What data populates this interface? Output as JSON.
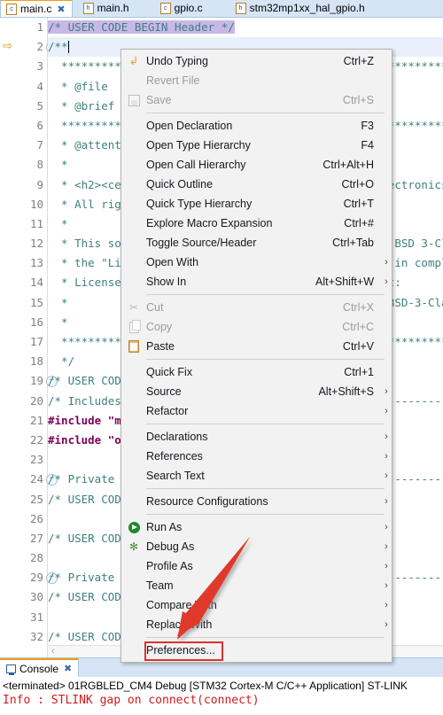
{
  "tabs": [
    {
      "label": "main.c",
      "icon": "c-file-icon",
      "icon_letter": "c",
      "active": true,
      "close": "✖"
    },
    {
      "label": "main.h",
      "icon": "h-file-icon",
      "icon_letter": "h",
      "active": false
    },
    {
      "label": "gpio.c",
      "icon": "c-file-icon",
      "icon_letter": "c",
      "active": false
    },
    {
      "label": "stm32mp1xx_hal_gpio.h",
      "icon": "h-file-icon",
      "icon_letter": "h",
      "active": false
    }
  ],
  "editor": {
    "marker_icon": "execution-arrow-icon",
    "hscroll_left_icon": "‹",
    "lines": [
      {
        "n": "1",
        "fold": false,
        "text": "/* USER CODE BEGIN Header */",
        "style": "cmt",
        "highlight": "selection"
      },
      {
        "n": "2",
        "fold": true,
        "text": "/**",
        "style": "cmt",
        "highlight": "line",
        "caret": true
      },
      {
        "n": "3",
        "fold": false,
        "text": "  ******************************************************************************",
        "style": "cmt"
      },
      {
        "n": "4",
        "fold": false,
        "text": "  * @file           : main.c",
        "style": "cmt"
      },
      {
        "n": "5",
        "fold": false,
        "text": "  * @brief          : Main program body",
        "style": "cmt"
      },
      {
        "n": "6",
        "fold": false,
        "text": "  ******************************************************************************",
        "style": "cmt"
      },
      {
        "n": "7",
        "fold": false,
        "text": "  * @attention",
        "style": "cmt"
      },
      {
        "n": "8",
        "fold": false,
        "text": "  *",
        "style": "cmt"
      },
      {
        "n": "9",
        "fold": false,
        "text": "  * <h2><center>&copy; Copyright (c) 2020 STMicroelectronics.",
        "style": "cmt"
      },
      {
        "n": "10",
        "fold": false,
        "text": "  * All rights reserved.</center></h2>",
        "style": "cmt"
      },
      {
        "n": "11",
        "fold": false,
        "text": "  *",
        "style": "cmt"
      },
      {
        "n": "12",
        "fold": false,
        "text": "  * This software component is licensed by ST under BSD 3-Clause license,",
        "style": "cmt"
      },
      {
        "n": "13",
        "fold": false,
        "text": "  * the \"License\"; You may not use this file except in compliance with the",
        "style": "cmt"
      },
      {
        "n": "14",
        "fold": false,
        "text": "  * License. You may obtain a copy of the License at:",
        "style": "cmt"
      },
      {
        "n": "15",
        "fold": false,
        "text": "  *                        opensource.org/licenses/BSD-3-Clause",
        "style": "cmt"
      },
      {
        "n": "16",
        "fold": false,
        "text": "  *",
        "style": "cmt"
      },
      {
        "n": "17",
        "fold": false,
        "text": "  ******************************************************************************",
        "style": "cmt"
      },
      {
        "n": "18",
        "fold": false,
        "text": "  */",
        "style": "cmt"
      },
      {
        "n": "19",
        "fold": true,
        "text": "/* USER CODE END Header */",
        "style": "cmt"
      },
      {
        "n": "20",
        "fold": false,
        "text": "/* Includes ------------------------------------------------------------------*/",
        "style": "cmt"
      },
      {
        "n": "21",
        "fold": false,
        "text": "#include \"main.h\"",
        "style": "pre"
      },
      {
        "n": "22",
        "fold": false,
        "text": "#include \"openamp.h\"",
        "style": "pre"
      },
      {
        "n": "23",
        "fold": false,
        "text": "",
        "style": ""
      },
      {
        "n": "24",
        "fold": true,
        "text": "/* Private includes ----------------------------------------------------------*/",
        "style": "cmt"
      },
      {
        "n": "25",
        "fold": false,
        "text": "/* USER CODE BEGIN Includes */",
        "style": "cmt"
      },
      {
        "n": "26",
        "fold": false,
        "text": "",
        "style": ""
      },
      {
        "n": "27",
        "fold": false,
        "text": "/* USER CODE END Includes */",
        "style": "cmt"
      },
      {
        "n": "28",
        "fold": false,
        "text": "",
        "style": ""
      },
      {
        "n": "29",
        "fold": true,
        "text": "/* Private typedef -----------------------------------------------------------*/",
        "style": "cmt"
      },
      {
        "n": "30",
        "fold": false,
        "text": "/* USER CODE BEGIN PTD */",
        "style": "cmt"
      },
      {
        "n": "31",
        "fold": false,
        "text": "",
        "style": ""
      },
      {
        "n": "32",
        "fold": false,
        "text": "/* USER CODE END PTD */",
        "style": "cmt"
      }
    ]
  },
  "context_menu": {
    "items": [
      {
        "type": "item",
        "name": "undo-typing",
        "label": "Undo Typing",
        "accel": "Ctrl+Z",
        "icon": "undo-icon",
        "disabled": false,
        "submenu": false
      },
      {
        "type": "item",
        "name": "revert-file",
        "label": "Revert File",
        "accel": "",
        "icon": "",
        "disabled": true,
        "submenu": false
      },
      {
        "type": "item",
        "name": "save",
        "label": "Save",
        "accel": "Ctrl+S",
        "icon": "save-icon",
        "disabled": true,
        "submenu": false
      },
      {
        "type": "sep"
      },
      {
        "type": "item",
        "name": "open-declaration",
        "label": "Open Declaration",
        "accel": "F3",
        "icon": "",
        "disabled": false,
        "submenu": false
      },
      {
        "type": "item",
        "name": "open-type-hierarchy",
        "label": "Open Type Hierarchy",
        "accel": "F4",
        "icon": "",
        "disabled": false,
        "submenu": false
      },
      {
        "type": "item",
        "name": "open-call-hierarchy",
        "label": "Open Call Hierarchy",
        "accel": "Ctrl+Alt+H",
        "icon": "",
        "disabled": false,
        "submenu": false
      },
      {
        "type": "item",
        "name": "quick-outline",
        "label": "Quick Outline",
        "accel": "Ctrl+O",
        "icon": "",
        "disabled": false,
        "submenu": false
      },
      {
        "type": "item",
        "name": "quick-type-hierarchy",
        "label": "Quick Type Hierarchy",
        "accel": "Ctrl+T",
        "icon": "",
        "disabled": false,
        "submenu": false
      },
      {
        "type": "item",
        "name": "explore-macro-expansion",
        "label": "Explore Macro Expansion",
        "accel": "Ctrl+#",
        "icon": "",
        "disabled": false,
        "submenu": false
      },
      {
        "type": "item",
        "name": "toggle-source-header",
        "label": "Toggle Source/Header",
        "accel": "Ctrl+Tab",
        "icon": "",
        "disabled": false,
        "submenu": false
      },
      {
        "type": "item",
        "name": "open-with",
        "label": "Open With",
        "accel": "",
        "icon": "",
        "disabled": false,
        "submenu": true
      },
      {
        "type": "item",
        "name": "show-in",
        "label": "Show In",
        "accel": "Alt+Shift+W",
        "icon": "",
        "disabled": false,
        "submenu": true
      },
      {
        "type": "sep"
      },
      {
        "type": "item",
        "name": "cut",
        "label": "Cut",
        "accel": "Ctrl+X",
        "icon": "cut-icon",
        "disabled": true,
        "submenu": false
      },
      {
        "type": "item",
        "name": "copy",
        "label": "Copy",
        "accel": "Ctrl+C",
        "icon": "copy-icon",
        "disabled": true,
        "submenu": false
      },
      {
        "type": "item",
        "name": "paste",
        "label": "Paste",
        "accel": "Ctrl+V",
        "icon": "paste-icon",
        "disabled": false,
        "submenu": false
      },
      {
        "type": "sep"
      },
      {
        "type": "item",
        "name": "quick-fix",
        "label": "Quick Fix",
        "accel": "Ctrl+1",
        "icon": "",
        "disabled": false,
        "submenu": false
      },
      {
        "type": "item",
        "name": "source",
        "label": "Source",
        "accel": "Alt+Shift+S",
        "icon": "",
        "disabled": false,
        "submenu": true
      },
      {
        "type": "item",
        "name": "refactor",
        "label": "Refactor",
        "accel": "",
        "icon": "",
        "disabled": false,
        "submenu": true
      },
      {
        "type": "sep"
      },
      {
        "type": "item",
        "name": "declarations",
        "label": "Declarations",
        "accel": "",
        "icon": "",
        "disabled": false,
        "submenu": true
      },
      {
        "type": "item",
        "name": "references",
        "label": "References",
        "accel": "",
        "icon": "",
        "disabled": false,
        "submenu": true
      },
      {
        "type": "item",
        "name": "search-text",
        "label": "Search Text",
        "accel": "",
        "icon": "",
        "disabled": false,
        "submenu": true
      },
      {
        "type": "sep"
      },
      {
        "type": "item",
        "name": "resource-configurations",
        "label": "Resource Configurations",
        "accel": "",
        "icon": "",
        "disabled": false,
        "submenu": true
      },
      {
        "type": "sep"
      },
      {
        "type": "item",
        "name": "run-as",
        "label": "Run As",
        "accel": "",
        "icon": "run-icon",
        "disabled": false,
        "submenu": true
      },
      {
        "type": "item",
        "name": "debug-as",
        "label": "Debug As",
        "accel": "",
        "icon": "debug-icon",
        "disabled": false,
        "submenu": true
      },
      {
        "type": "item",
        "name": "profile-as",
        "label": "Profile As",
        "accel": "",
        "icon": "",
        "disabled": false,
        "submenu": true
      },
      {
        "type": "item",
        "name": "team",
        "label": "Team",
        "accel": "",
        "icon": "",
        "disabled": false,
        "submenu": true
      },
      {
        "type": "item",
        "name": "compare-with",
        "label": "Compare With",
        "accel": "",
        "icon": "",
        "disabled": false,
        "submenu": true
      },
      {
        "type": "item",
        "name": "replace-with",
        "label": "Replace With",
        "accel": "",
        "icon": "",
        "disabled": false,
        "submenu": true
      },
      {
        "type": "sep"
      },
      {
        "type": "item",
        "name": "preferences",
        "label": "Preferences...",
        "accel": "",
        "icon": "",
        "disabled": false,
        "submenu": false,
        "highlighted": true
      }
    ],
    "submenu_glyph": "›"
  },
  "annotation": {
    "arrow_color": "#e0392b",
    "highlight_color": "#e03030",
    "target": "Preferences..."
  },
  "console": {
    "tab_label": "Console",
    "tab_icon": "console-icon",
    "tab_close": "✖",
    "line1": "<terminated> 01RGBLED_CM4 Debug [STM32 Cortex-M C/C++ Application] ST-LINK",
    "line2": "Info : STLINK gap on connect(connect)"
  }
}
